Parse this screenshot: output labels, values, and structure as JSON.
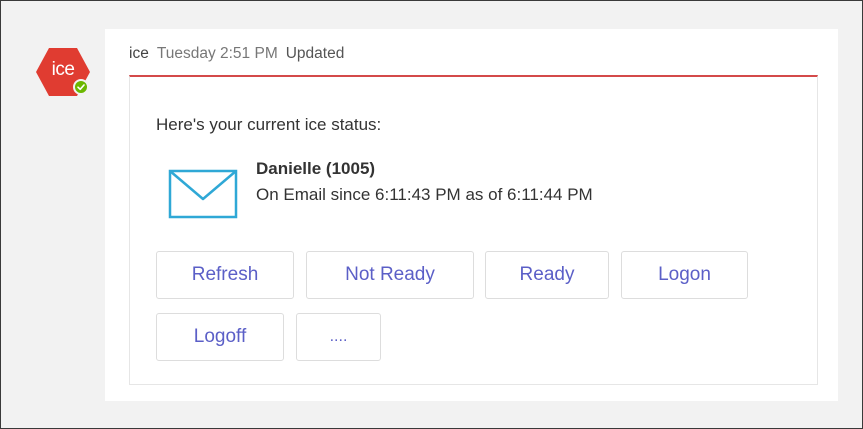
{
  "bot": {
    "avatar_text": "ice",
    "avatar_color": "#e03c31",
    "presence": "available",
    "presence_color": "#6bb700"
  },
  "message": {
    "sender": "ice",
    "timestamp": "Tuesday 2:51 PM",
    "edited_label": "Updated",
    "accent_color": "#d44a4a"
  },
  "card": {
    "intro": "Here's your current ice status:",
    "status_icon": "envelope-icon",
    "status_icon_color": "#2fa8d6",
    "agent_name": "Danielle (1005)",
    "status_text": "On Email since 6:11:43 PM as of 6:11:44 PM",
    "actions": {
      "refresh": "Refresh",
      "not_ready": "Not Ready",
      "ready": "Ready",
      "logon": "Logon",
      "logoff": "Logoff",
      "more": "...."
    }
  }
}
